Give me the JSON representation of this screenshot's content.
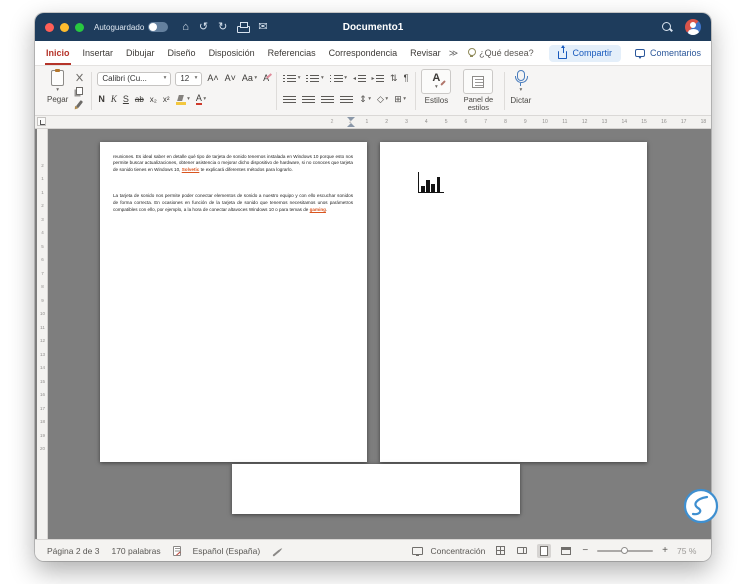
{
  "titlebar": {
    "autosave": "Autoguardado",
    "title": "Documento1"
  },
  "tabs": {
    "items": [
      "Inicio",
      "Insertar",
      "Dibujar",
      "Diseño",
      "Disposición",
      "Referencias",
      "Correspondencia",
      "Revisar"
    ],
    "active": "Inicio",
    "overflow": "≫",
    "tell_me": "¿Qué desea?",
    "share": "Compartir",
    "comments": "Comentarios"
  },
  "ribbon": {
    "paste": "Pegar",
    "font_name": "Calibri (Cu...",
    "font_size": "12",
    "grow": "A˄",
    "shrink": "A˅",
    "case": "Aa",
    "clear": "A",
    "bold": "N",
    "italic": "K",
    "underline": "S",
    "strike": "ab",
    "subscript": "x₂",
    "superscript": "x²",
    "font_color": "A",
    "styles": "Estilos",
    "styles_icon": "A",
    "styles_panel": "Panel de estilos",
    "dictate": "Dictar"
  },
  "icons": {
    "caret": "▾",
    "pilcrow": "¶",
    "sort": "⇅",
    "line_spacing": "⇕",
    "shading": "◇",
    "borders": "⊞",
    "home": "⌂",
    "undo": "↺",
    "redo": "↻",
    "mail": "✉",
    "indent_decrease": "◂",
    "indent_increase": "▸"
  },
  "ruler": {
    "h_margin": [
      "2",
      "1"
    ],
    "h_numbers": [
      "1",
      "2",
      "3",
      "4",
      "5",
      "6",
      "7",
      "8",
      "9",
      "10",
      "11",
      "12",
      "13",
      "14",
      "15",
      "16",
      "17",
      "18"
    ],
    "v_numbers": [
      "2",
      "1",
      "1",
      "2",
      "3",
      "4",
      "5",
      "6",
      "7",
      "8",
      "9",
      "10",
      "11",
      "12",
      "13",
      "14",
      "15",
      "16",
      "17",
      "18",
      "19",
      "20"
    ]
  },
  "document": {
    "page1": {
      "para1_pre": "reuniones. Es ideal saber en detalle qué tipo de tarjeta de sonido tenemos instalada en Windows 10 porque esto nos permite buscar actualizaciones, obtener asistencia o mejorar dicho dispositivo de hardware, si no conoces que tarjeta de sonido tienes en Windows 10, ",
      "link1": "Solvetic",
      "para1_post": " te explicará diferentes métodos para lograrlo.",
      "para2_pre": "La tarjeta de sonido nos permite poder conectar elementos de sonido a nuestro equipo y con ello escuchar sonidos de forma correcta. En ocasiones en función de la tarjeta de sonido que tenemos necesitamos unos parámetros compatibles con ello, por ejemplo, a la hora de conectar altavoces Windows 10 o para temas de ",
      "link2": "gaming",
      "para2_post": "."
    }
  },
  "statusbar": {
    "page": "Página 2 de 3",
    "words": "170 palabras",
    "language": "Español (España)",
    "focus": "Concentración",
    "zoom_out": "−",
    "zoom_in": "+",
    "zoom": "75 %"
  }
}
